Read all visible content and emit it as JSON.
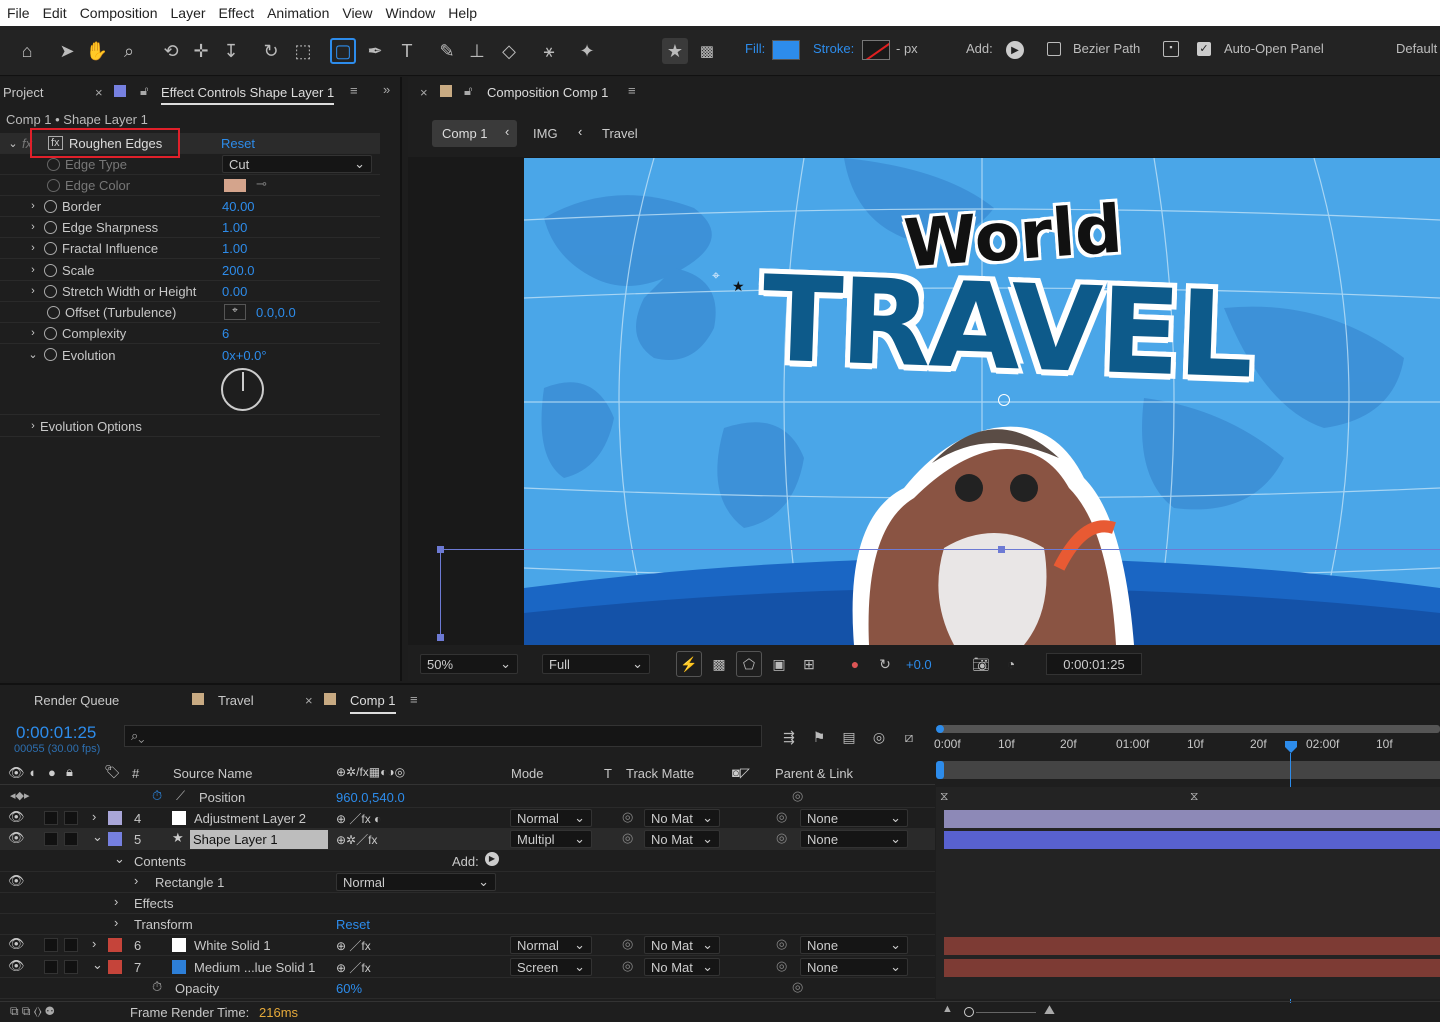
{
  "menu": [
    "File",
    "Edit",
    "Composition",
    "Layer",
    "Effect",
    "Animation",
    "View",
    "Window",
    "Help"
  ],
  "toolbar": {
    "fill_label": "Fill:",
    "stroke_label": "Stroke:",
    "stroke_unit": "- px",
    "add_label": "Add:",
    "bezier_label": "Bezier Path",
    "auto_open_label": "Auto-Open Panel",
    "workspace": "Default"
  },
  "left_panel": {
    "project_tab": "Project",
    "effect_tab": "Effect Controls Shape Layer 1",
    "breadcrumb": "Comp 1 • Shape Layer 1",
    "effect_name": "Roughen Edges",
    "reset": "Reset",
    "props": [
      {
        "name": "Edge Type",
        "value": "Cut"
      },
      {
        "name": "Edge Color",
        "value": ""
      },
      {
        "name": "Border",
        "value": "40.00"
      },
      {
        "name": "Edge Sharpness",
        "value": "1.00"
      },
      {
        "name": "Fractal Influence",
        "value": "1.00"
      },
      {
        "name": "Scale",
        "value": "200.0"
      },
      {
        "name": "Stretch Width or Height",
        "value": "0.00"
      },
      {
        "name": "Offset (Turbulence)",
        "value": "0.0,0.0"
      },
      {
        "name": "Complexity",
        "value": "6"
      },
      {
        "name": "Evolution",
        "value": "0x+0.0°"
      },
      {
        "name": "Evolution Options",
        "value": ""
      }
    ]
  },
  "comp_panel": {
    "tab": "Composition Comp 1",
    "crumbs": [
      "Comp 1",
      "IMG",
      "Travel"
    ],
    "title_top": "World",
    "title_main": "TRAVEL",
    "zoom": "50%",
    "resolution": "Full",
    "exposure": "+0.0",
    "timecode": "0:00:01:25"
  },
  "timeline": {
    "tabs": [
      "Render Queue",
      "Travel",
      "Comp 1"
    ],
    "timecode": "0:00:01:25",
    "fps": "00055 (30.00 fps)",
    "ruler": [
      "0:00f",
      "10f",
      "20f",
      "01:00f",
      "10f",
      "20f",
      "02:00f",
      "10f"
    ],
    "headers": {
      "source": "Source Name",
      "mode": "Mode",
      "t": "T",
      "matte": "Track Matte",
      "parent": "Parent & Link",
      "num": "#"
    },
    "rows": [
      {
        "kind": "prop",
        "name": "Position",
        "value": "960.0,540.0"
      },
      {
        "kind": "layer",
        "num": "4",
        "name": "Adjustment Layer 2",
        "mode": "Normal",
        "matte": "No Mat",
        "parent": "None"
      },
      {
        "kind": "layer",
        "num": "5",
        "name": "Shape Layer 1",
        "mode": "Multipl",
        "matte": "No Mat",
        "parent": "None"
      },
      {
        "kind": "group",
        "name": "Contents",
        "extra": "Add:"
      },
      {
        "kind": "sub",
        "name": "Rectangle 1",
        "mode": "Normal"
      },
      {
        "kind": "sub",
        "name": "Effects"
      },
      {
        "kind": "sub",
        "name": "Transform",
        "value": "Reset"
      },
      {
        "kind": "layer",
        "num": "6",
        "name": "White Solid 1",
        "mode": "Normal",
        "matte": "No Mat",
        "parent": "None"
      },
      {
        "kind": "layer",
        "num": "7",
        "name": "Medium ...lue Solid 1",
        "mode": "Screen",
        "matte": "No Mat",
        "parent": "None"
      },
      {
        "kind": "prop",
        "name": "Opacity",
        "value": "60%"
      }
    ],
    "render_time_label": "Frame Render Time:",
    "render_time": "216ms"
  },
  "colors": {
    "accent": "#2d8ceb",
    "highlight_box": "#e0202a",
    "sky": "#4aa6e8",
    "travel_text": "#0d5a8a"
  }
}
